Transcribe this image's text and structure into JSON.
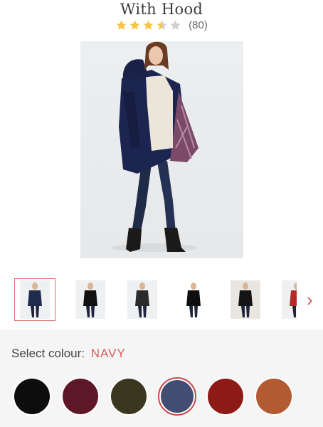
{
  "product": {
    "title": "With Hood",
    "rating": 3.5,
    "review_count": "(80)"
  },
  "main_image": {
    "label": "navy-hooded-coat-photo"
  },
  "thumbnails": [
    {
      "coat": "#1e2a4e",
      "bg": "#eef0f2",
      "active": true
    },
    {
      "coat": "#111111",
      "bg": "#eef0f2",
      "active": false
    },
    {
      "coat": "#2b2b2b",
      "bg": "#eef0f2",
      "active": false
    },
    {
      "coat": "#0e0e0e",
      "bg": "#ffffff",
      "active": false
    },
    {
      "coat": "#151515",
      "bg": "#e9e6e2",
      "active": false
    },
    {
      "coat": "#b52a25",
      "bg": "#eef0f2",
      "active": false
    }
  ],
  "next_arrow": "›",
  "colour": {
    "label": "Select colour:",
    "selected": "NAVY",
    "swatches": [
      {
        "hex": "#0d0d0d",
        "active": false
      },
      {
        "hex": "#5e1726",
        "active": false
      },
      {
        "hex": "#3a3620",
        "active": false
      },
      {
        "hex": "#434d74",
        "active": true
      },
      {
        "hex": "#8e1a18",
        "active": false
      },
      {
        "hex": "#b45a33",
        "active": false
      }
    ]
  },
  "colors": {
    "accent": "#d65c5c",
    "star": "#f4c542",
    "star_empty": "#cfcfcf"
  }
}
